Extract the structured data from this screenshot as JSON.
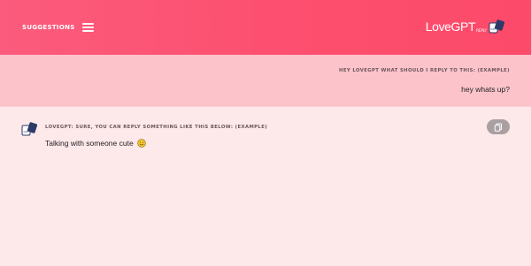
{
  "header": {
    "suggestions_label": "SUGGESTIONS",
    "brand_title": "LoveGPT",
    "brand_sub": "REPLY"
  },
  "question": {
    "label": "HEY LOVEGPT WHAT SHOULD I REPLY TO THIS: (EXAMPLE)",
    "text": "hey whats up?"
  },
  "answer": {
    "label": "LOVEGPT: SURE, YOU CAN REPLY SOMETHING LIKE THIS BELOW: (EXAMPLE)",
    "text": "Talking with someone cute",
    "emoji_icon": "smiley-icon"
  },
  "icons": {
    "menu": "hamburger-icon",
    "logo": "lovegpt-logo-icon",
    "copy": "copy-icon"
  },
  "colors": {
    "header": "#fc4e6f",
    "question_band": "#fcc3cb",
    "answer_band": "#fde8ea",
    "copy_button": "#aaa0a2"
  }
}
